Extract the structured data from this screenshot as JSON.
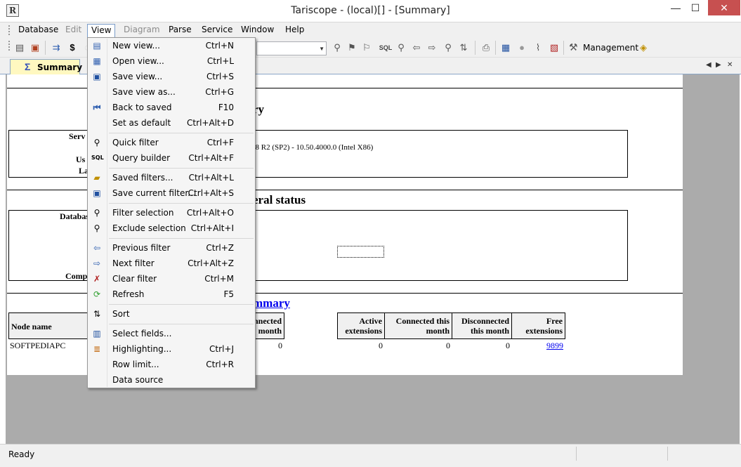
{
  "window": {
    "title": "Tariscope - (local)[] - [Summary]",
    "app_icon": "R",
    "min_glyph": "—",
    "max_glyph": "☐",
    "close_glyph": "✕"
  },
  "menubar": [
    "Database",
    "Edit",
    "View",
    "Diagram",
    "Parse",
    "Service",
    "Window",
    "Help"
  ],
  "toolbar": {
    "management_label": "Management",
    "icons": [
      "database-icon",
      "database-settings-icon",
      "export-icon",
      "dollar-icon",
      "watermark-icon",
      "filter-icon",
      "filter-save-icon",
      "sql-icon",
      "filter-clear-icon",
      "back-arrow-icon",
      "forward-arrow-icon",
      "filter-exclude-icon",
      "sort-icon",
      "print-icon",
      "table-icon",
      "circle-icon",
      "chart-icon",
      "report-icon",
      "tools-icon",
      "cube-icon"
    ]
  },
  "tabs": {
    "summary_label": "Summary",
    "summary_glyph": "Σ",
    "nav_left": "◀",
    "nav_right": "▶",
    "nav_close": "✕"
  },
  "report": {
    "header_fragment": "ry",
    "server_label_fragment": "Serv",
    "user_label_fragment": "Us",
    "last_label_fragment": "La",
    "server_version_fragment": "08 R2 (SP2) - 10.50.4000.0 (Intel X86)",
    "general_status_fragment": "eral status",
    "database_label_fragment": "Databas",
    "computer_label_fragment": "Comp",
    "summary_link_fragment": "mmary",
    "node_table": {
      "headers": {
        "node_name": "Node name",
        "connected_month": "nnected month",
        "active_extensions": "Active extensions",
        "connected_this_month": "Connected this month",
        "disconnected_this_month": "Disconnected this month",
        "free_extensions": "Free extensions"
      },
      "row": {
        "node_name": "SOFTPEDIAPC",
        "connected_month": "0",
        "active_extensions": "0",
        "connected_this_month": "0",
        "disconnected_this_month": "0",
        "free_extensions": "9899"
      }
    }
  },
  "view_menu": [
    {
      "label": "New view...",
      "shortcut": "Ctrl+N",
      "icon": "new-view-icon"
    },
    {
      "label": "Open view...",
      "shortcut": "Ctrl+L",
      "icon": "open-view-icon"
    },
    {
      "label": "Save view...",
      "shortcut": "Ctrl+S",
      "icon": "save-view-icon"
    },
    {
      "label": "Save view as...",
      "shortcut": "Ctrl+G",
      "icon": ""
    },
    {
      "label": "Back to saved",
      "shortcut": "F10",
      "icon": "back-to-saved-icon"
    },
    {
      "label": "Set as default",
      "shortcut": "Ctrl+Alt+D",
      "icon": ""
    },
    {
      "label": "Quick filter",
      "shortcut": "Ctrl+F",
      "icon": "quick-filter-icon"
    },
    {
      "label": "Query builder",
      "shortcut": "Ctrl+Alt+F",
      "icon": "sql-icon"
    },
    {
      "label": "Saved filters...",
      "shortcut": "Ctrl+Alt+L",
      "icon": "saved-filters-icon"
    },
    {
      "label": "Save current filter...",
      "shortcut": "Ctrl+Alt+S",
      "icon": "save-filter-icon"
    },
    {
      "label": "Filter selection",
      "shortcut": "Ctrl+Alt+O",
      "icon": "filter-selection-icon"
    },
    {
      "label": "Exclude selection",
      "shortcut": "Ctrl+Alt+I",
      "icon": "exclude-selection-icon"
    },
    {
      "label": "Previous filter",
      "shortcut": "Ctrl+Z",
      "icon": "previous-arrow-icon"
    },
    {
      "label": "Next filter",
      "shortcut": "Ctrl+Alt+Z",
      "icon": "next-arrow-icon"
    },
    {
      "label": "Clear filter",
      "shortcut": "Ctrl+M",
      "icon": "clear-filter-icon"
    },
    {
      "label": "Refresh",
      "shortcut": "F5",
      "icon": "refresh-icon"
    },
    {
      "label": "Sort",
      "shortcut": "",
      "icon": "sort-icon"
    },
    {
      "label": "Select fields...",
      "shortcut": "",
      "icon": "select-fields-icon"
    },
    {
      "label": "Highlighting...",
      "shortcut": "Ctrl+J",
      "icon": "highlighting-icon"
    },
    {
      "label": "Row limit...",
      "shortcut": "Ctrl+R",
      "icon": ""
    },
    {
      "label": "Data source",
      "shortcut": "",
      "icon": ""
    }
  ],
  "status": {
    "text": "Ready"
  }
}
